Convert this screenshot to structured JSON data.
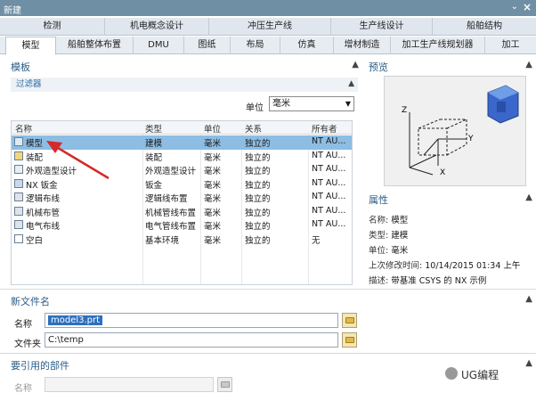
{
  "window": {
    "title": "新建"
  },
  "tabs_row1": [
    "检测",
    "机电概念设计",
    "冲压生产线",
    "生产线设计",
    "船舶结构"
  ],
  "tabs_row2": [
    "模型",
    "船舶整体布置",
    "DMU",
    "图纸",
    "布局",
    "仿真",
    "增材制造",
    "加工生产线规划器",
    "加工"
  ],
  "template": {
    "title": "模板",
    "filter_title": "过滤器",
    "unit_label": "单位",
    "unit_value": "毫米",
    "columns": [
      "名称",
      "类型",
      "单位",
      "关系",
      "所有者"
    ],
    "rows": [
      {
        "name": "模型",
        "type": "建模",
        "unit": "毫米",
        "relation": "独立的",
        "owner": "NT AU..."
      },
      {
        "name": "装配",
        "type": "装配",
        "unit": "毫米",
        "relation": "独立的",
        "owner": "NT AU..."
      },
      {
        "name": "外观造型设计",
        "type": "外观造型设计",
        "unit": "毫米",
        "relation": "独立的",
        "owner": "NT AU..."
      },
      {
        "name": "NX 钣金",
        "type": "钣金",
        "unit": "毫米",
        "relation": "独立的",
        "owner": "NT AU..."
      },
      {
        "name": "逻辑布线",
        "type": "逻辑线布置",
        "unit": "毫米",
        "relation": "独立的",
        "owner": "NT AU..."
      },
      {
        "name": "机械布管",
        "type": "机械管线布置",
        "unit": "毫米",
        "relation": "独立的",
        "owner": "NT AU..."
      },
      {
        "name": "电气布线",
        "type": "电气管线布置",
        "unit": "毫米",
        "relation": "独立的",
        "owner": "NT AU..."
      },
      {
        "name": "空白",
        "type": "基本环境",
        "unit": "毫米",
        "relation": "独立的",
        "owner": "无"
      }
    ]
  },
  "preview": {
    "title": "预览",
    "axis_z": "Z",
    "axis_y": "Y",
    "axis_x": "X"
  },
  "properties": {
    "title": "属性",
    "name_k": "名称:",
    "name_v": "模型",
    "type_k": "类型:",
    "type_v": "建模",
    "unit_k": "单位:",
    "unit_v": "毫米",
    "modified_k": "上次修改时间:",
    "modified_v": "10/14/2015 01:34 上午",
    "desc_k": "描述:",
    "desc_v": "带基准 CSYS 的 NX 示例"
  },
  "new_file": {
    "title": "新文件名",
    "name_label": "名称",
    "name_value": "model3.prt",
    "folder_label": "文件夹",
    "folder_value": "C:\\temp"
  },
  "ref_part": {
    "title": "要引用的部件",
    "name_label": "名称"
  },
  "watermark": "UG编程"
}
